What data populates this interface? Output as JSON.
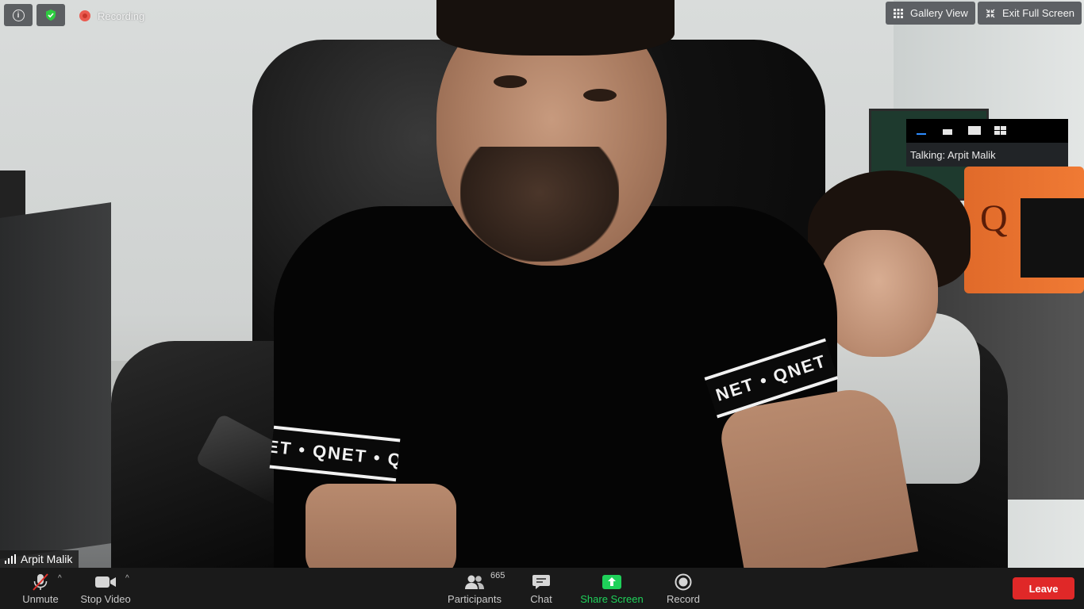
{
  "top_left": {
    "info_icon": "info-icon",
    "security_icon": "shield-check-icon",
    "recording_label": "Recording",
    "recording_color": "#ea5a4f",
    "security_color": "#2ecc40"
  },
  "top_right": {
    "gallery_view_label": "Gallery View",
    "exit_full_screen_label": "Exit Full Screen"
  },
  "speaker_panel": {
    "talking_label": "Talking: Arpit Malik"
  },
  "video": {
    "participant_name": "Arpit Malik",
    "sleeve_text_left": "ET • QNET • Q",
    "sleeve_text_right": "NET • QNET"
  },
  "toolbar": {
    "unmute_label": "Unmute",
    "stop_video_label": "Stop Video",
    "participants_label": "Participants",
    "participants_count": "665",
    "chat_label": "Chat",
    "share_screen_label": "Share Screen",
    "record_label": "Record",
    "leave_label": "Leave",
    "share_color": "#1fd15a",
    "leave_color": "#e02828"
  }
}
